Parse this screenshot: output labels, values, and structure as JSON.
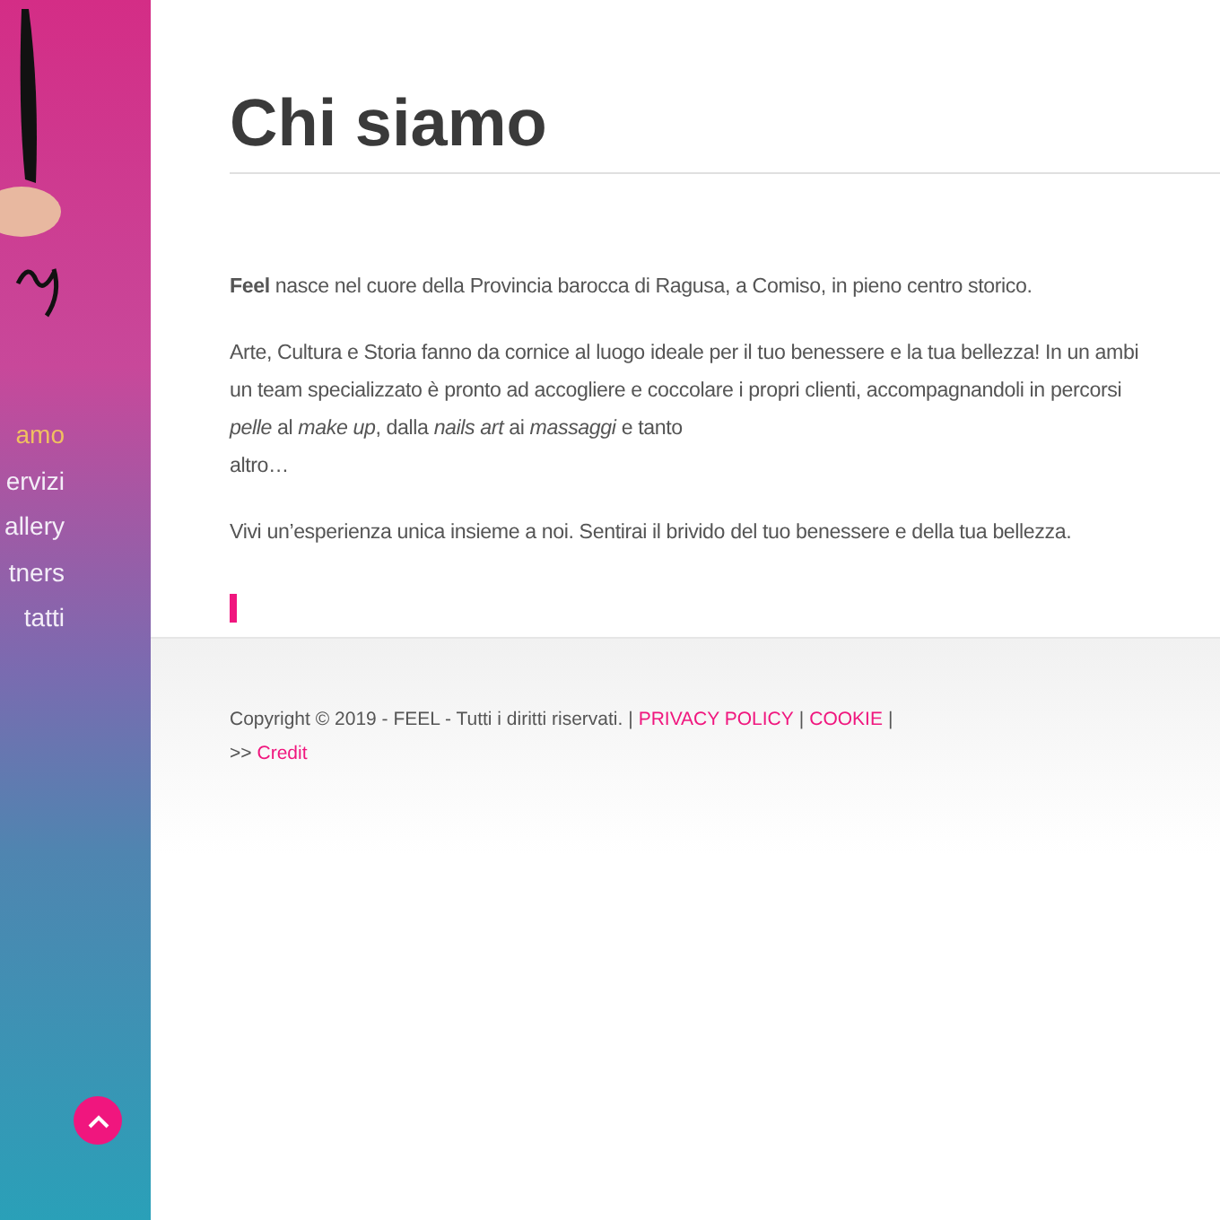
{
  "sidebar": {
    "menu": [
      {
        "label": "amo",
        "selected": true
      },
      {
        "label": "ervizi",
        "selected": false
      },
      {
        "label": "allery",
        "selected": false
      },
      {
        "label": "tners",
        "selected": false
      },
      {
        "label": "tatti",
        "selected": false
      }
    ]
  },
  "page": {
    "title": "Chi siamo",
    "paragraphs": [
      [
        "**Feel** nasce nel cuore della Provincia barocca di Ragusa, a Comiso, in pieno centro storico."
      ],
      [
        "Arte, Cultura e Storia fanno da cornice al luogo ideale per il tuo benessere e la tua bellezza! In un ambi",
        "un team specializzato è pronto ad accogliere e coccolare i propri clienti, accompagnandoli in percorsi",
        "*pelle* al *make up*, dalla *nails art* ai *massaggi* e tanto",
        "altro…"
      ],
      [
        "Vivi un’esperienza unica insieme a noi. Sentirai il brivido del tuo benessere e della tua bellezza."
      ]
    ]
  },
  "footer": {
    "copyright": "Copyright © 2019 - FEEL - Tutti i diritti riservati. |",
    "links": [
      "PRIVACY POLICY",
      "COOKIE"
    ],
    "separator": "|",
    "prefix": ">>",
    "credit": "Credit"
  }
}
